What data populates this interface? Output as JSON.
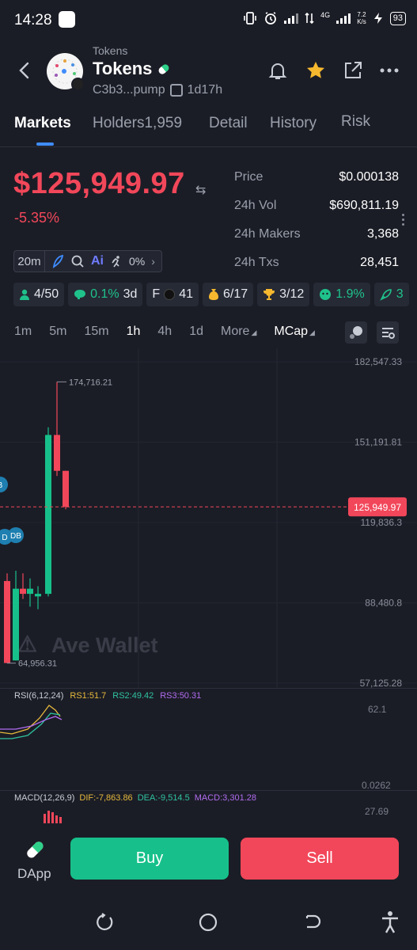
{
  "status_bar": {
    "time": "14:28",
    "net_speed_value": "7.2",
    "net_speed_unit": "K/s",
    "network": "4G",
    "battery": "93"
  },
  "header": {
    "label": "Tokens",
    "title": "Tokens",
    "address": "C3b3...pump",
    "age": "1d17h"
  },
  "tabs": [
    {
      "label": "Markets"
    },
    {
      "label": "Holders1,959"
    },
    {
      "label": "Detail"
    },
    {
      "label": "History"
    },
    {
      "label": "Risk"
    }
  ],
  "price": {
    "value": "$125,949.97",
    "change": "-5.35%"
  },
  "stats": [
    {
      "label": "Price",
      "value": "$0.000138"
    },
    {
      "label": "24h Vol",
      "value": "$690,811.19"
    },
    {
      "label": "24h Makers",
      "value": "3,368"
    },
    {
      "label": "24h Txs",
      "value": "28,451"
    }
  ],
  "tool_chip": {
    "timeframe": "20m",
    "ai_label": "Ai",
    "progress": "0%"
  },
  "badges": {
    "holders_ratio": "4/50",
    "top_pct": "0.1%",
    "top_period": "3d",
    "f_prefix": "F",
    "f_count": "41",
    "bag": "6/17",
    "trophy": "3/12",
    "snipe_pct": "1.9%",
    "last": "3"
  },
  "timeframes": {
    "items": [
      "1m",
      "5m",
      "15m",
      "1h",
      "4h",
      "1d"
    ],
    "active": "1h",
    "more": "More",
    "mcap": "MCap"
  },
  "chart_data": {
    "type": "candlestick",
    "watermark": "Ave Wallet",
    "y_ticks": [
      "182,547.33",
      "151,191.81",
      "119,836.3",
      "88,480.8",
      "57,125.28"
    ],
    "current_value": "125,949.97",
    "high_label": "174,716.21",
    "low_label": "64,956.31",
    "markers": [
      "B",
      "D",
      "DB"
    ],
    "candles": [
      {
        "open": 97000,
        "close": 65000,
        "high": 100000,
        "low": 64956.31,
        "color": "red"
      },
      {
        "open": 66000,
        "close": 94000,
        "high": 101000,
        "low": 66000,
        "color": "green"
      },
      {
        "open": 94000,
        "close": 92000,
        "high": 100000,
        "low": 90000,
        "color": "red"
      },
      {
        "open": 92000,
        "close": 94000,
        "high": 98000,
        "low": 87000,
        "color": "green"
      },
      {
        "open": 91000,
        "close": 92000,
        "high": 95000,
        "low": 86000,
        "color": "green"
      },
      {
        "open": 92000,
        "close": 154000,
        "high": 157000,
        "low": 91000,
        "color": "green"
      },
      {
        "open": 154000,
        "close": 140000,
        "high": 174716.21,
        "low": 138000,
        "color": "red"
      },
      {
        "open": 140000,
        "close": 125949.97,
        "high": 140000,
        "low": 125000,
        "color": "red"
      }
    ],
    "ylim": [
      57125.28,
      182547.33
    ]
  },
  "rsi": {
    "label": "RSI(6,12,24)",
    "rs1": "RS1:51.7",
    "rs2": "RS2:49.42",
    "rs3": "RS3:50.31",
    "top": "62.1",
    "bottom": "0.0262"
  },
  "macd": {
    "label": "MACD(12,26,9)",
    "dif": "DIF:-7,863.86",
    "dea": "DEA:-9,514.5",
    "macd": "MACD:3,301.28",
    "top": "27.69"
  },
  "bottom": {
    "dapp": "DApp",
    "buy": "Buy",
    "sell": "Sell"
  },
  "colors": {
    "up": "#17c08a",
    "down": "#f2475a",
    "accent": "#3f8cff",
    "background": "#1b1d26"
  }
}
